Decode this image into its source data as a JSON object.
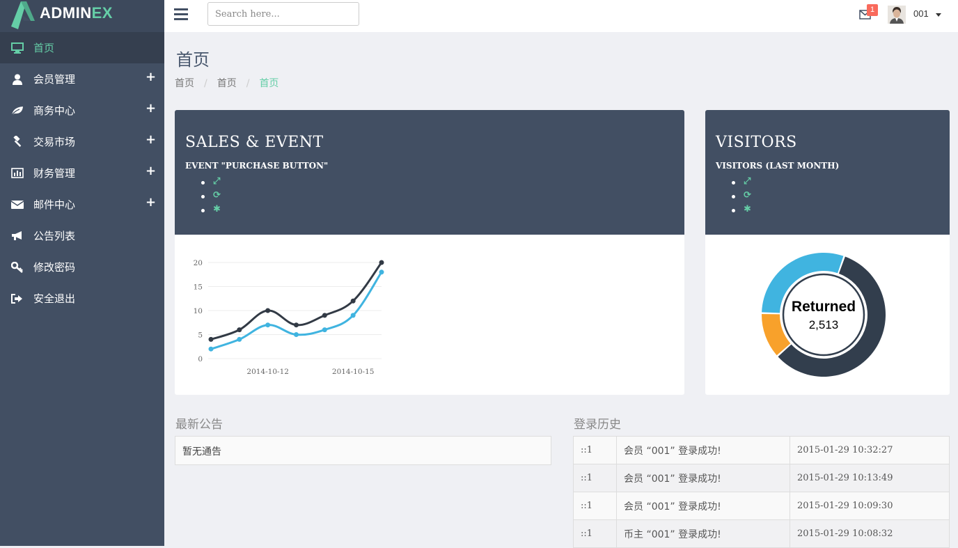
{
  "brand": {
    "name_a": "ADMIN",
    "name_b": "EX"
  },
  "sidebar": {
    "items": [
      {
        "label": "首页",
        "icon": "desktop-icon",
        "active": true
      },
      {
        "label": "会员管理",
        "icon": "user-icon",
        "expand": "+"
      },
      {
        "label": "商务中心",
        "icon": "leaf-icon",
        "expand": "+"
      },
      {
        "label": "交易市场",
        "icon": "gavel-icon",
        "expand": "+"
      },
      {
        "label": "财务管理",
        "icon": "bar-chart-icon",
        "expand": "+"
      },
      {
        "label": "邮件中心",
        "icon": "envelope-icon",
        "expand": "+"
      },
      {
        "label": "公告列表",
        "icon": "bullhorn-icon"
      },
      {
        "label": "修改密码",
        "icon": "key-icon"
      },
      {
        "label": "安全退出",
        "icon": "sign-out-icon"
      }
    ]
  },
  "header": {
    "search_placeholder": "Search here...",
    "mail_count": "1",
    "username": "001"
  },
  "page": {
    "title": "首页",
    "breadcrumb": [
      "首页",
      "首页",
      "首页"
    ]
  },
  "sales_panel": {
    "title": "SALES & EVENT",
    "subtitle": "EVENT \"PURCHASE BUTTON\"",
    "tools": [
      "expand-icon",
      "refresh-icon",
      "cog-icon"
    ]
  },
  "visitors_panel": {
    "title": "VISITORS",
    "subtitle": "VISITORS (LAST MONTH)",
    "tools": [
      "expand-icon",
      "refresh-icon",
      "cog-icon"
    ]
  },
  "chart_data": [
    {
      "type": "line",
      "x": [
        "2014-10-10",
        "2014-10-11",
        "2014-10-12",
        "2014-10-13",
        "2014-10-14",
        "2014-10-15",
        "2014-10-16"
      ],
      "x_ticks": [
        "2014-10-12",
        "2014-10-15"
      ],
      "y_ticks": [
        0,
        5,
        10,
        15,
        20
      ],
      "ylim": [
        0,
        20
      ],
      "grid": true,
      "series": [
        {
          "color": "#323a45",
          "values": [
            4,
            6,
            10,
            7,
            9,
            12,
            20
          ]
        },
        {
          "color": "#40b4e0",
          "values": [
            2,
            4,
            7,
            5,
            6,
            9,
            18
          ]
        }
      ]
    },
    {
      "type": "pie",
      "style": "donut",
      "center_label": "Returned",
      "center_value": "2,513",
      "slices": [
        {
          "color": "#323e4d",
          "value": 58
        },
        {
          "color": "#f8a12b",
          "value": 12
        },
        {
          "color": "#40b4e0",
          "value": 30
        }
      ]
    }
  ],
  "notices": {
    "title": "最新公告",
    "empty_text": "暂无通告"
  },
  "login_history": {
    "title": "登录历史",
    "rows": [
      {
        "ip": "::1",
        "message": "会员 “001” 登录成功!",
        "time": "2015-01-29 10:32:27"
      },
      {
        "ip": "::1",
        "message": "会员 “001” 登录成功!",
        "time": "2015-01-29 10:13:49"
      },
      {
        "ip": "::1",
        "message": "会员 “001” 登录成功!",
        "time": "2015-01-29 10:09:30"
      },
      {
        "ip": "::1",
        "message": "币主 “001” 登录成功!",
        "time": "2015-01-29 10:08:32"
      }
    ]
  }
}
